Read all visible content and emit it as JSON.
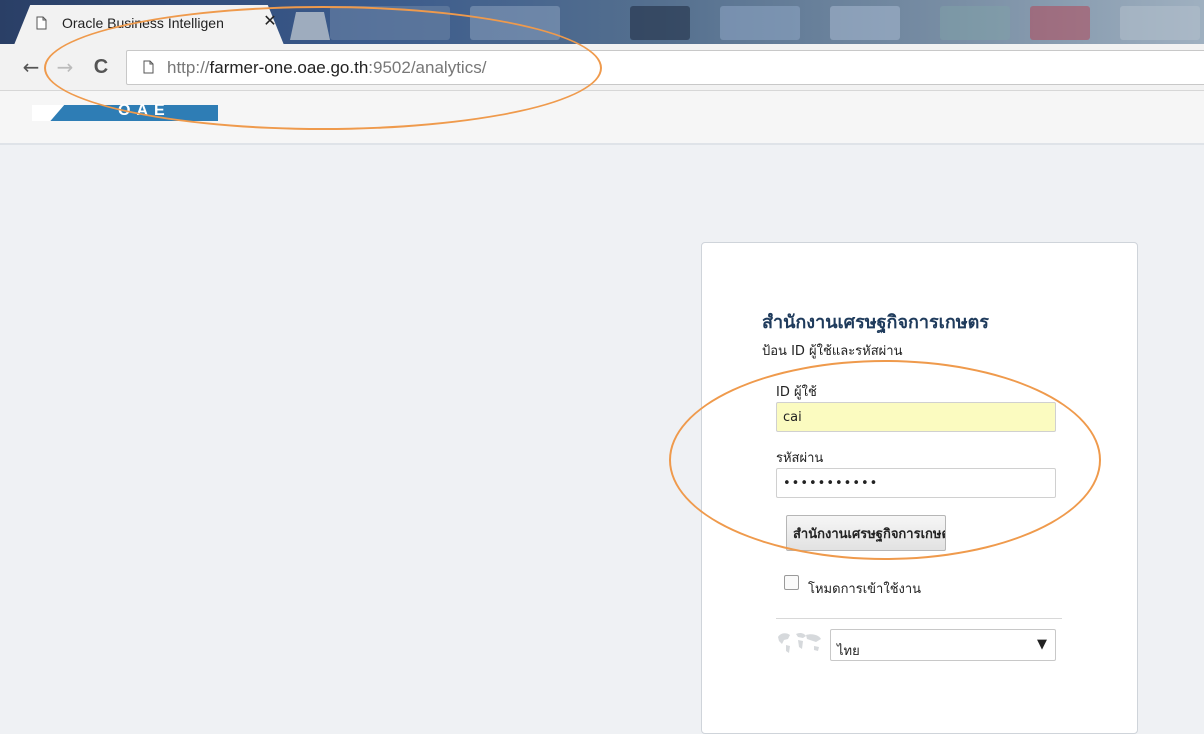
{
  "browser": {
    "tab_title": "Oracle Business Intelligen",
    "tab_close": "✕",
    "back": "←",
    "forward": "→",
    "reload": "C",
    "url_scheme": "http://",
    "url_host": "farmer-one.oae.go.th",
    "url_rest": ":9502/analytics/"
  },
  "app": {
    "logo_text": "OAE"
  },
  "login": {
    "org_title": "สำนักงานเศรษฐกิจการเกษตร",
    "instructions": "ป้อน ID ผู้ใช้และรหัสผ่าน",
    "user_label": "ID ผู้ใช้",
    "user_value": "cai",
    "password_label": "รหัสผ่าน",
    "password_value": "•••••••••••",
    "signin_label": "สำนักงานเศรษฐกิจการเกษตร",
    "accessibility_label": "โหมดการเข้าใช้งาน",
    "language_value": "ไทย",
    "language_arrow": "▼"
  },
  "annotation": {
    "color": "#ef9a4c"
  }
}
